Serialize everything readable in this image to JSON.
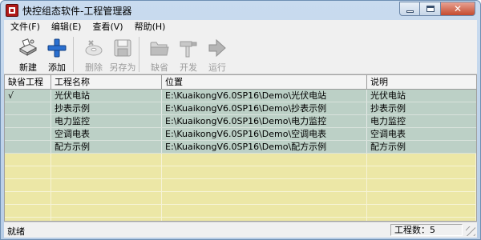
{
  "window": {
    "title": "快控组态软件-工程管理器",
    "close_glyph": "✕"
  },
  "menu": [
    "文件(F)",
    "编辑(E)",
    "查看(V)",
    "帮助(H)"
  ],
  "toolbar": [
    {
      "label": "新建",
      "icon": "new-project-icon",
      "enabled": true
    },
    {
      "label": "添加",
      "icon": "plus-icon",
      "enabled": true
    },
    {
      "label": "删除",
      "icon": "delete-disk-icon",
      "enabled": false
    },
    {
      "label": "另存为",
      "icon": "save-icon",
      "enabled": false
    },
    {
      "label": "缺省",
      "icon": "folder-icon",
      "enabled": false
    },
    {
      "label": "开发",
      "icon": "hammer-icon",
      "enabled": false
    },
    {
      "label": "运行",
      "icon": "run-arrow-icon",
      "enabled": false
    }
  ],
  "table": {
    "columns": [
      "缺省工程",
      "工程名称",
      "位置",
      "说明"
    ],
    "rows": [
      {
        "default": "√",
        "name": "光伏电站",
        "path": "E:\\KuaikongV6.0SP16\\Demo\\光伏电站",
        "desc": "光伏电站"
      },
      {
        "default": "",
        "name": "抄表示例",
        "path": "E:\\KuaikongV6.0SP16\\Demo\\抄表示例",
        "desc": "抄表示例"
      },
      {
        "default": "",
        "name": "电力监控",
        "path": "E:\\KuaikongV6.0SP16\\Demo\\电力监控",
        "desc": "电力监控"
      },
      {
        "default": "",
        "name": "空调电表",
        "path": "E:\\KuaikongV6.0SP16\\Demo\\空调电表",
        "desc": "空调电表"
      },
      {
        "default": "",
        "name": "配方示例",
        "path": "E:\\KuaikongV6.0SP16\\Demo\\配方示例",
        "desc": "配方示例"
      }
    ]
  },
  "status": {
    "left": "就绪",
    "right": "工程数：5"
  },
  "colors": {
    "row_filled": "#bcd0c6",
    "grid_empty": "#ece7a6",
    "plus_blue": "#2a6fd0"
  }
}
